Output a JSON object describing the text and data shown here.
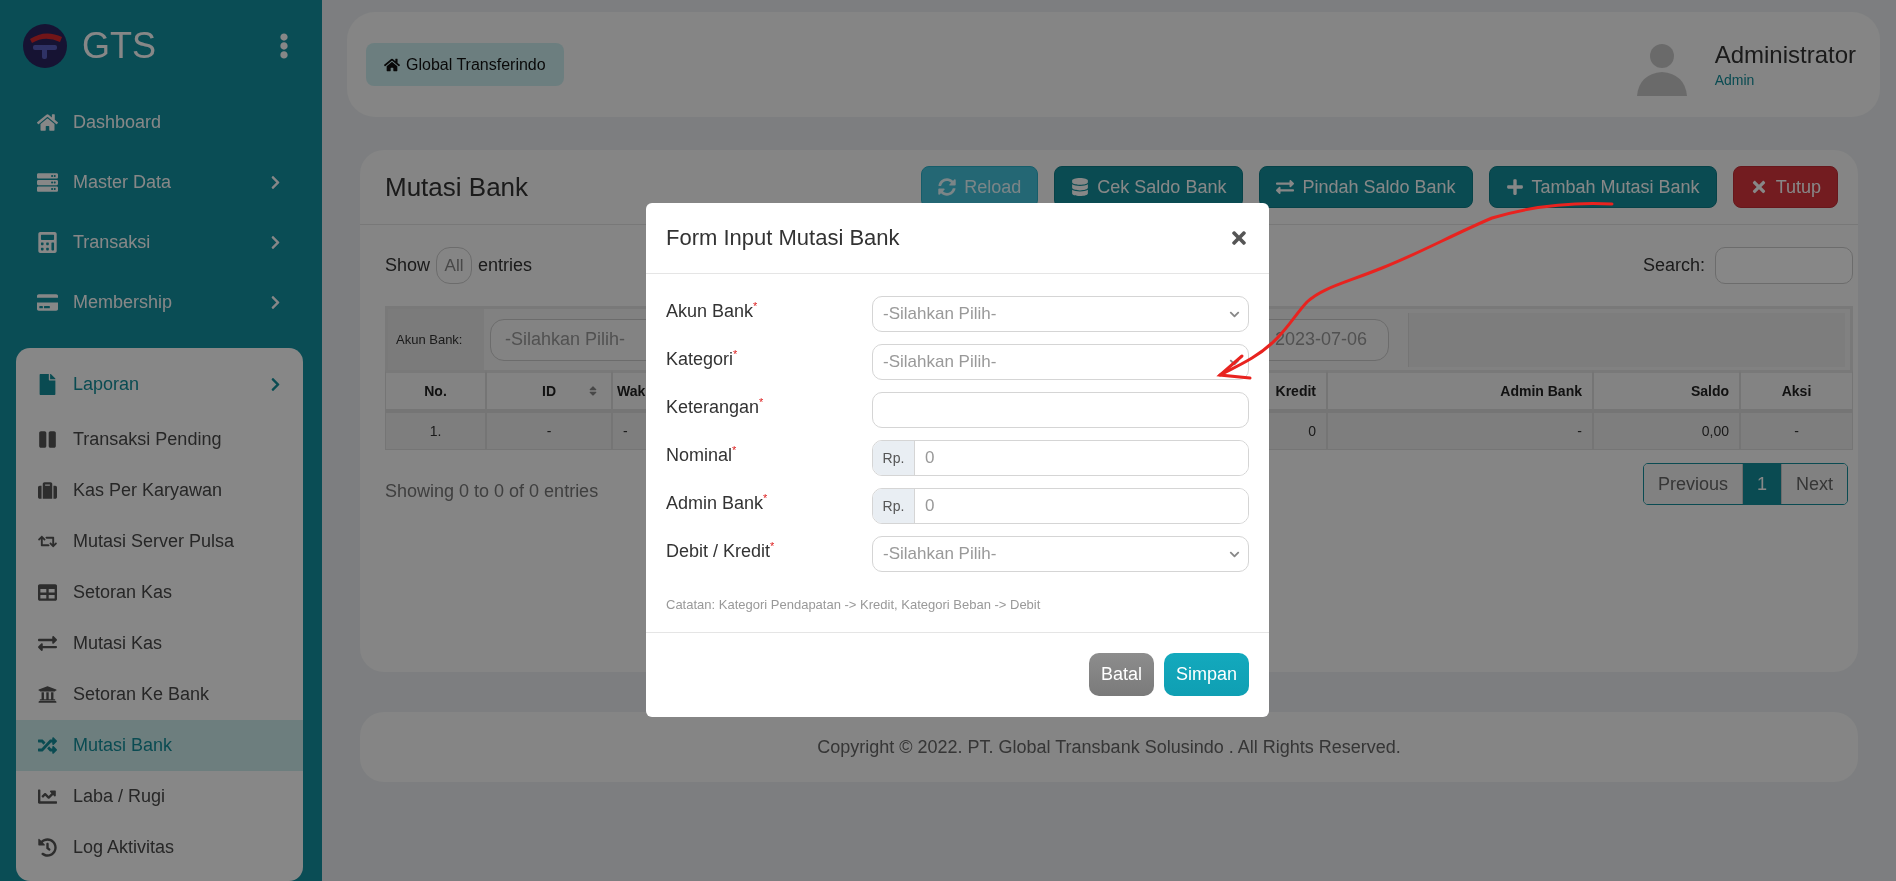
{
  "sidebar": {
    "brand": "GTS",
    "items": [
      {
        "label": "Dashboard",
        "kind": "link",
        "expanded": false
      },
      {
        "label": "Master Data",
        "kind": "group",
        "expanded": false
      },
      {
        "label": "Transaksi",
        "kind": "group",
        "expanded": false
      },
      {
        "label": "Membership",
        "kind": "group",
        "expanded": false
      },
      {
        "label": "Laporan",
        "kind": "group",
        "expanded": true,
        "children": [
          {
            "label": "Transaksi Pending",
            "selected": false
          },
          {
            "label": "Kas Per Karyawan",
            "selected": false
          },
          {
            "label": "Mutasi Server Pulsa",
            "selected": false
          },
          {
            "label": "Setoran Kas",
            "selected": false
          },
          {
            "label": "Mutasi Kas",
            "selected": false
          },
          {
            "label": "Setoran Ke Bank",
            "selected": false
          },
          {
            "label": "Mutasi Bank",
            "selected": true
          },
          {
            "label": "Laba / Rugi",
            "selected": false
          },
          {
            "label": "Log Aktivitas",
            "selected": false
          }
        ]
      }
    ]
  },
  "header": {
    "home_button": "Global Transferindo",
    "user": {
      "name": "Administrator",
      "role": "Admin"
    }
  },
  "page": {
    "title": "Mutasi Bank",
    "actions": [
      {
        "label": "Reload",
        "kind": "reload"
      },
      {
        "label": "Cek Saldo Bank",
        "kind": "check"
      },
      {
        "label": "Pindah Saldo Bank",
        "kind": "move"
      },
      {
        "label": "Tambah Mutasi Bank",
        "kind": "add"
      },
      {
        "label": "Tutup",
        "kind": "close"
      }
    ],
    "length": {
      "prefix": "Show",
      "value": "All",
      "suffix": "entries"
    },
    "search": {
      "label": "Search:"
    },
    "filter": {
      "label": "Akun Bank:",
      "select": "-Silahkan Pilih-",
      "date": "2023-07-06"
    },
    "table": {
      "columns": [
        "No.",
        "ID",
        "Wak",
        "Kredit",
        "Admin Bank",
        "Saldo",
        "Aksi"
      ],
      "rows": [
        [
          "1.",
          "-",
          "-",
          "0",
          "-",
          "0,00",
          "-"
        ]
      ]
    },
    "info": "Showing 0 to 0 of 0 entries",
    "pagination": [
      {
        "label": "Previous",
        "selected": false
      },
      {
        "label": "1",
        "selected": true
      },
      {
        "label": "Next",
        "selected": false
      }
    ]
  },
  "footer": "Copyright © 2022. PT. Global Transbank Solusindo . All Rights Reserved.",
  "modal": {
    "title": "Form Input Mutasi Bank",
    "fields": [
      {
        "label": "Akun Bank$^{*}$",
        "kind": "select",
        "placeholder": "-Silahkan Pilih-"
      },
      {
        "label": "Kategori$^{*}$",
        "kind": "select",
        "placeholder": "-Silahkan Pilih-"
      },
      {
        "label": "Keterangan$^{*}$",
        "kind": "text"
      },
      {
        "label": "Nominal$^{*}$",
        "kind": "money",
        "prefix": "Rp.",
        "placeholder": "0"
      },
      {
        "label": "Admin Bank$^{*}$",
        "kind": "money",
        "prefix": "Rp.",
        "placeholder": "0"
      },
      {
        "label": "Debit / Kredit$^{*}$",
        "kind": "select",
        "placeholder": "-Silahkan Pilih-"
      }
    ],
    "note": "Catatan: Kategori Pendapatan -> Kredit, Kategori Beban -> Debit",
    "buttons": [
      {
        "label": "Batal",
        "kind": "secondary"
      },
      {
        "label": "Simpan",
        "kind": "primary"
      }
    ]
  }
}
